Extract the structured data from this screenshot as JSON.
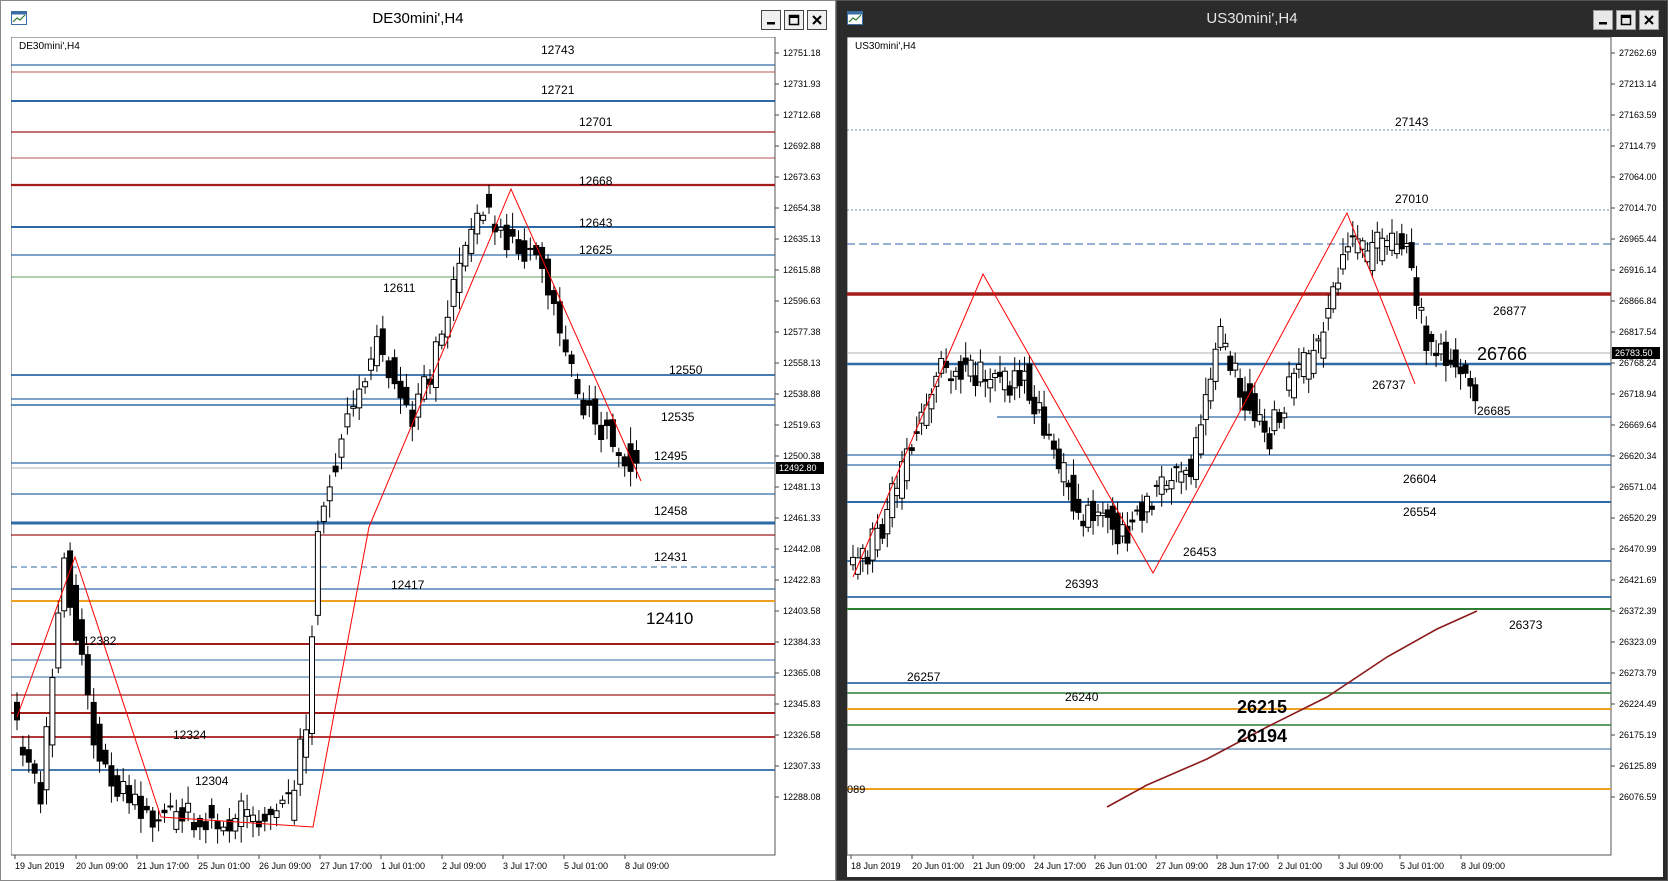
{
  "windows": [
    {
      "id": "left",
      "title": "DE30mini',H4",
      "symbol_label": "DE30mini',H4",
      "current_price": "12492.80",
      "price_axis": [
        "12751.18",
        "12731.93",
        "12712.68",
        "12692.88",
        "12673.63",
        "12654.38",
        "12635.13",
        "12615.88",
        "12596.63",
        "12577.38",
        "12558.13",
        "12538.88",
        "12519.63",
        "12500.38",
        "12481.13",
        "12461.33",
        "12442.08",
        "12422.83",
        "12403.58",
        "12384.33",
        "12365.08",
        "12345.83",
        "12326.58",
        "12307.33",
        "12288.08"
      ],
      "time_axis": [
        "19 Jun 2019",
        "20 Jun 09:00",
        "21 Jun 17:00",
        "25 Jun 01:00",
        "26 Jun 09:00",
        "27 Jun 17:00",
        "1 Jul 01:00",
        "2 Jul 09:00",
        "3 Jul 17:00",
        "5 Jul 01:00",
        "8 Jul 09:00"
      ],
      "level_labels": [
        "12743",
        "12721",
        "12701",
        "12668",
        "12643",
        "12625",
        "12611",
        "12550",
        "12535",
        "12495",
        "12458",
        "12431",
        "12417",
        "12410",
        "12382",
        "12324",
        "12304"
      ]
    },
    {
      "id": "right",
      "title": "US30mini',H4",
      "symbol_label": "US30mini',H4",
      "current_price": "26783.50",
      "price_axis": [
        "27262.69",
        "27213.14",
        "27163.59",
        "27114.79",
        "27064.00",
        "27014.70",
        "26965.44",
        "26916.14",
        "26866.84",
        "26817.54",
        "26768.24",
        "26718.94",
        "26669.64",
        "26620.34",
        "26571.04",
        "26520.29",
        "26470.99",
        "26421.69",
        "26372.39",
        "26323.09",
        "26273.79",
        "26224.49",
        "26175.19",
        "26125.89",
        "26076.59"
      ],
      "time_axis": [
        "18 Jun 2019",
        "20 Jun 01:00",
        "21 Jun 09:00",
        "24 Jun 17:00",
        "26 Jun 01:00",
        "27 Jun 09:00",
        "28 Jun 17:00",
        "2 Jul 01:00",
        "3 Jul 09:00",
        "5 Jul 01:00",
        "8 Jul 09:00"
      ],
      "level_labels": [
        "27143",
        "27010",
        "26877",
        "26766",
        "26737",
        "26685",
        "26604",
        "26554",
        "26453",
        "26393",
        "26373",
        "26257",
        "26240",
        "26215",
        "26194",
        "089"
      ]
    }
  ],
  "colors": {
    "candle": "#000000",
    "blue_level": "#2e6aa6",
    "red_level": "#a51c1c",
    "orange_level": "#f0a020",
    "green_level": "#2e7d32",
    "zigzag": "#ff0000",
    "ma_line": "#8b1a1a"
  },
  "icons": [
    "chart-window-icon",
    "minimize-icon",
    "restore-icon",
    "close-icon"
  ]
}
